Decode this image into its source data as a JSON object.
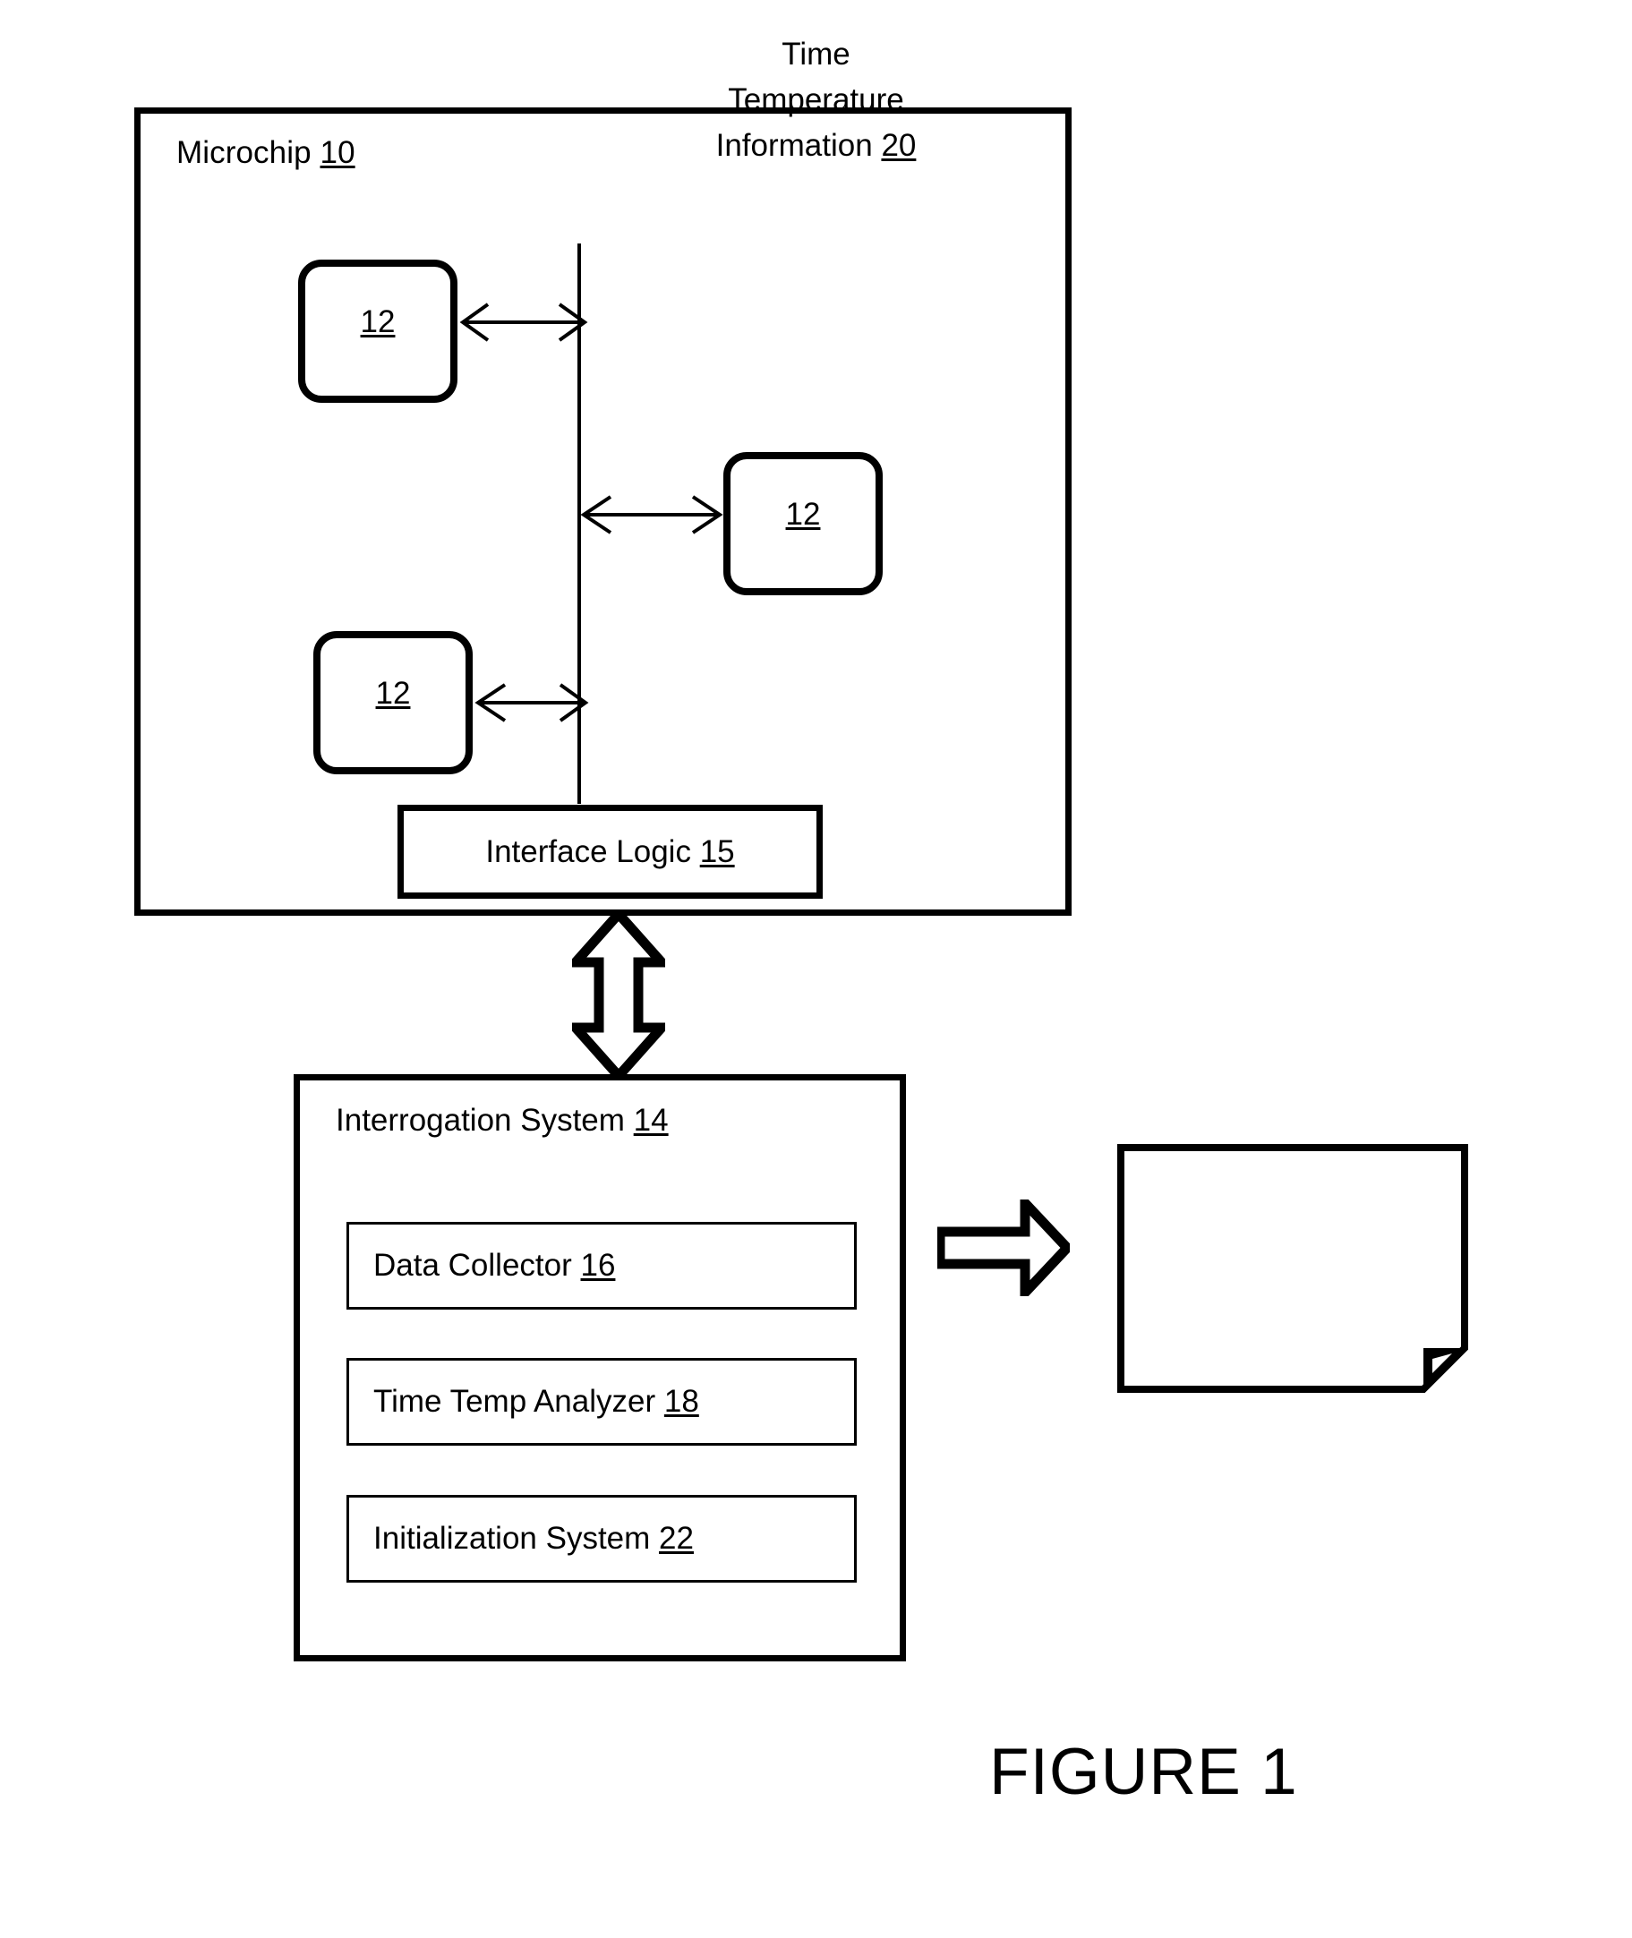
{
  "figure": {
    "caption": "FIGURE 1"
  },
  "microchip": {
    "title_text": "Microchip",
    "title_ref": "10",
    "sensors": [
      {
        "ref": "12"
      },
      {
        "ref": "12"
      },
      {
        "ref": "12"
      }
    ],
    "interface_logic": {
      "label": "Interface Logic",
      "ref": "15"
    }
  },
  "interrogation_system": {
    "title_text": "Interrogation System",
    "title_ref": "14",
    "modules": [
      {
        "label": "Data Collector",
        "ref": "16"
      },
      {
        "label": "Time Temp Analyzer",
        "ref": "18"
      },
      {
        "label": "Initialization System",
        "ref": "22"
      }
    ]
  },
  "output_document": {
    "lines": [
      "Time",
      "Temperature",
      "Information"
    ],
    "ref": "20"
  },
  "colors": {
    "stroke": "#000000",
    "background": "#ffffff"
  },
  "icons": {
    "bus_connector_arrow": "double-headed-arrow",
    "chip_to_system_arrow": "block-double-arrow-vertical",
    "system_to_output_arrow": "block-arrow-right",
    "document_fold": "page-corner-fold"
  }
}
